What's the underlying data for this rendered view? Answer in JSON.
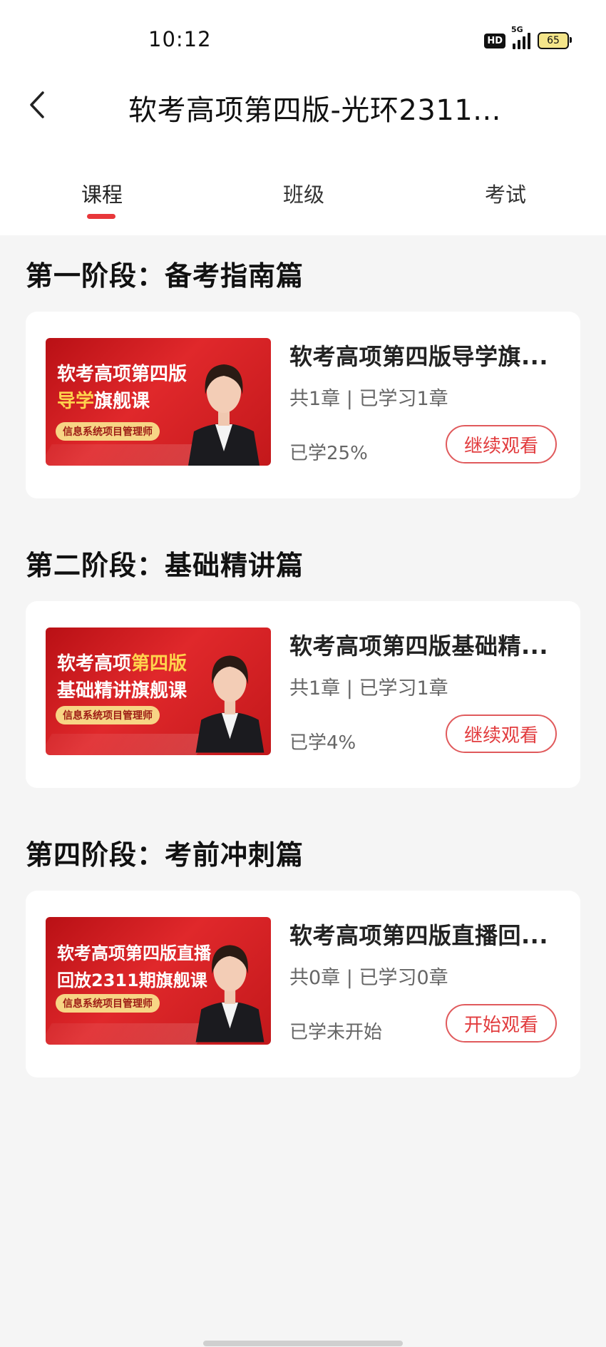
{
  "status_bar": {
    "time": "10:12",
    "hd": "HD",
    "network": "5G",
    "battery": "65"
  },
  "header": {
    "title": "软考高项第四版-光环2311..."
  },
  "tabs": [
    {
      "label": "课程",
      "active": true
    },
    {
      "label": "班级",
      "active": false
    },
    {
      "label": "考试",
      "active": false
    }
  ],
  "accent_color": "#e8373a",
  "sections": [
    {
      "title": "第一阶段：备考指南篇",
      "course": {
        "title": "软考高项第四版导学旗...",
        "meta": "共1章 | 已学习1章",
        "progress": "已学25%",
        "button": "继续观看",
        "thumb": {
          "line1a": "软考高项第四版",
          "line1b": "",
          "line2a": "导学",
          "line2b": "旗舰课",
          "badge": "信息系统项目管理师"
        }
      }
    },
    {
      "title": "第二阶段：基础精讲篇",
      "course": {
        "title": "软考高项第四版基础精...",
        "meta": "共1章 | 已学习1章",
        "progress": "已学4%",
        "button": "继续观看",
        "thumb": {
          "line1a": "软考高项",
          "line1b": "第四版",
          "line2a": "基础精讲旗舰课",
          "line2b": "",
          "badge": "信息系统项目管理师"
        }
      }
    },
    {
      "title": "第四阶段：考前冲刺篇",
      "course": {
        "title": "软考高项第四版直播回...",
        "meta": "共0章 | 已学习0章",
        "progress": "已学未开始",
        "button": "开始观看",
        "thumb": {
          "line1a": "软考高项第四版直播",
          "line1b": "",
          "line2a": "回放2311期旗舰课",
          "line2b": "",
          "badge": "信息系统项目管理师"
        }
      }
    }
  ]
}
